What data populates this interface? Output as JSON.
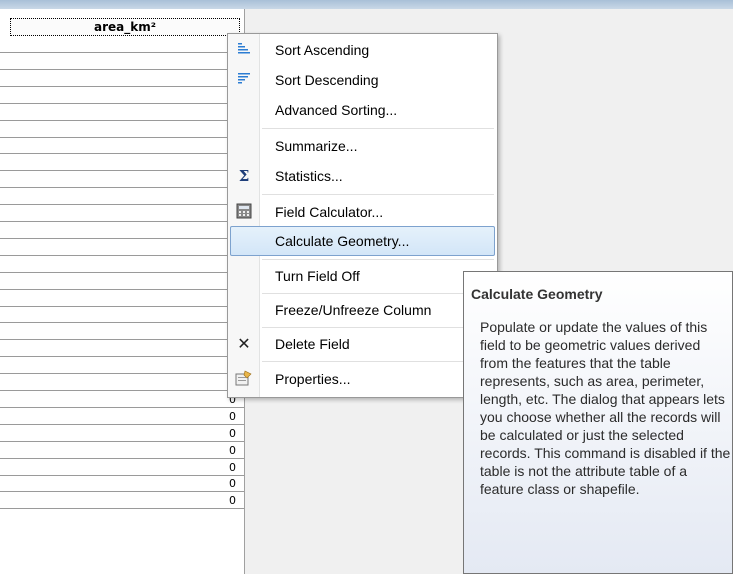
{
  "table": {
    "column_header": "area_km²",
    "blank_rows": 20,
    "zero_rows": [
      "0",
      "0",
      "0",
      "0",
      "0",
      "0",
      "0",
      "0"
    ]
  },
  "context_menu": {
    "items": [
      {
        "label": "Sort Ascending",
        "icon": "sort-ascending-icon"
      },
      {
        "label": "Sort Descending",
        "icon": "sort-descending-icon"
      },
      {
        "label": "Advanced Sorting...",
        "icon": ""
      },
      {
        "label": "Summarize...",
        "icon": ""
      },
      {
        "label": "Statistics...",
        "icon": "sigma-icon"
      },
      {
        "label": "Field Calculator...",
        "icon": "calculator-icon"
      },
      {
        "label": "Calculate Geometry...",
        "icon": "",
        "highlighted": true
      },
      {
        "label": "Turn Field Off",
        "icon": ""
      },
      {
        "label": "Freeze/Unfreeze Column",
        "icon": ""
      },
      {
        "label": "Delete Field",
        "icon": "delete-x-icon"
      },
      {
        "label": "Properties...",
        "icon": "properties-icon"
      }
    ]
  },
  "tooltip": {
    "title": "Calculate Geometry",
    "body": "Populate or update the values of this field to be geometric values derived from the features that the table represents, such as area, perimeter, length, etc. The dialog that appears lets you choose whether all the records will be calculated or just the selected records. This command is disabled if the table is not the attribute table of a feature class or shapefile."
  },
  "colors": {
    "highlight_border": "#7da2ce",
    "highlight_fill": "#d3e6f8",
    "background": "#f0f0f0"
  }
}
